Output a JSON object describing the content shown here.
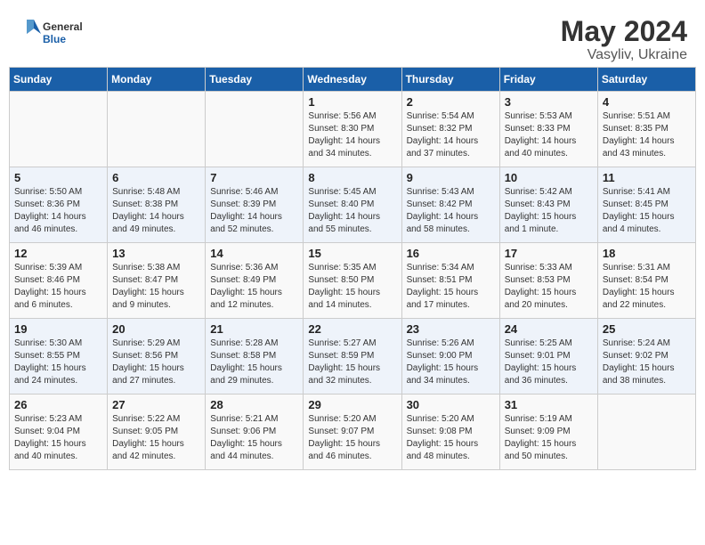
{
  "header": {
    "logo_line1": "General",
    "logo_line2": "Blue",
    "title": "May 2024",
    "location": "Vasyliv, Ukraine"
  },
  "days_of_week": [
    "Sunday",
    "Monday",
    "Tuesday",
    "Wednesday",
    "Thursday",
    "Friday",
    "Saturday"
  ],
  "weeks": [
    [
      {
        "day": "",
        "info": ""
      },
      {
        "day": "",
        "info": ""
      },
      {
        "day": "",
        "info": ""
      },
      {
        "day": "1",
        "info": "Sunrise: 5:56 AM\nSunset: 8:30 PM\nDaylight: 14 hours\nand 34 minutes."
      },
      {
        "day": "2",
        "info": "Sunrise: 5:54 AM\nSunset: 8:32 PM\nDaylight: 14 hours\nand 37 minutes."
      },
      {
        "day": "3",
        "info": "Sunrise: 5:53 AM\nSunset: 8:33 PM\nDaylight: 14 hours\nand 40 minutes."
      },
      {
        "day": "4",
        "info": "Sunrise: 5:51 AM\nSunset: 8:35 PM\nDaylight: 14 hours\nand 43 minutes."
      }
    ],
    [
      {
        "day": "5",
        "info": "Sunrise: 5:50 AM\nSunset: 8:36 PM\nDaylight: 14 hours\nand 46 minutes."
      },
      {
        "day": "6",
        "info": "Sunrise: 5:48 AM\nSunset: 8:38 PM\nDaylight: 14 hours\nand 49 minutes."
      },
      {
        "day": "7",
        "info": "Sunrise: 5:46 AM\nSunset: 8:39 PM\nDaylight: 14 hours\nand 52 minutes."
      },
      {
        "day": "8",
        "info": "Sunrise: 5:45 AM\nSunset: 8:40 PM\nDaylight: 14 hours\nand 55 minutes."
      },
      {
        "day": "9",
        "info": "Sunrise: 5:43 AM\nSunset: 8:42 PM\nDaylight: 14 hours\nand 58 minutes."
      },
      {
        "day": "10",
        "info": "Sunrise: 5:42 AM\nSunset: 8:43 PM\nDaylight: 15 hours\nand 1 minute."
      },
      {
        "day": "11",
        "info": "Sunrise: 5:41 AM\nSunset: 8:45 PM\nDaylight: 15 hours\nand 4 minutes."
      }
    ],
    [
      {
        "day": "12",
        "info": "Sunrise: 5:39 AM\nSunset: 8:46 PM\nDaylight: 15 hours\nand 6 minutes."
      },
      {
        "day": "13",
        "info": "Sunrise: 5:38 AM\nSunset: 8:47 PM\nDaylight: 15 hours\nand 9 minutes."
      },
      {
        "day": "14",
        "info": "Sunrise: 5:36 AM\nSunset: 8:49 PM\nDaylight: 15 hours\nand 12 minutes."
      },
      {
        "day": "15",
        "info": "Sunrise: 5:35 AM\nSunset: 8:50 PM\nDaylight: 15 hours\nand 14 minutes."
      },
      {
        "day": "16",
        "info": "Sunrise: 5:34 AM\nSunset: 8:51 PM\nDaylight: 15 hours\nand 17 minutes."
      },
      {
        "day": "17",
        "info": "Sunrise: 5:33 AM\nSunset: 8:53 PM\nDaylight: 15 hours\nand 20 minutes."
      },
      {
        "day": "18",
        "info": "Sunrise: 5:31 AM\nSunset: 8:54 PM\nDaylight: 15 hours\nand 22 minutes."
      }
    ],
    [
      {
        "day": "19",
        "info": "Sunrise: 5:30 AM\nSunset: 8:55 PM\nDaylight: 15 hours\nand 24 minutes."
      },
      {
        "day": "20",
        "info": "Sunrise: 5:29 AM\nSunset: 8:56 PM\nDaylight: 15 hours\nand 27 minutes."
      },
      {
        "day": "21",
        "info": "Sunrise: 5:28 AM\nSunset: 8:58 PM\nDaylight: 15 hours\nand 29 minutes."
      },
      {
        "day": "22",
        "info": "Sunrise: 5:27 AM\nSunset: 8:59 PM\nDaylight: 15 hours\nand 32 minutes."
      },
      {
        "day": "23",
        "info": "Sunrise: 5:26 AM\nSunset: 9:00 PM\nDaylight: 15 hours\nand 34 minutes."
      },
      {
        "day": "24",
        "info": "Sunrise: 5:25 AM\nSunset: 9:01 PM\nDaylight: 15 hours\nand 36 minutes."
      },
      {
        "day": "25",
        "info": "Sunrise: 5:24 AM\nSunset: 9:02 PM\nDaylight: 15 hours\nand 38 minutes."
      }
    ],
    [
      {
        "day": "26",
        "info": "Sunrise: 5:23 AM\nSunset: 9:04 PM\nDaylight: 15 hours\nand 40 minutes."
      },
      {
        "day": "27",
        "info": "Sunrise: 5:22 AM\nSunset: 9:05 PM\nDaylight: 15 hours\nand 42 minutes."
      },
      {
        "day": "28",
        "info": "Sunrise: 5:21 AM\nSunset: 9:06 PM\nDaylight: 15 hours\nand 44 minutes."
      },
      {
        "day": "29",
        "info": "Sunrise: 5:20 AM\nSunset: 9:07 PM\nDaylight: 15 hours\nand 46 minutes."
      },
      {
        "day": "30",
        "info": "Sunrise: 5:20 AM\nSunset: 9:08 PM\nDaylight: 15 hours\nand 48 minutes."
      },
      {
        "day": "31",
        "info": "Sunrise: 5:19 AM\nSunset: 9:09 PM\nDaylight: 15 hours\nand 50 minutes."
      },
      {
        "day": "",
        "info": ""
      }
    ]
  ]
}
